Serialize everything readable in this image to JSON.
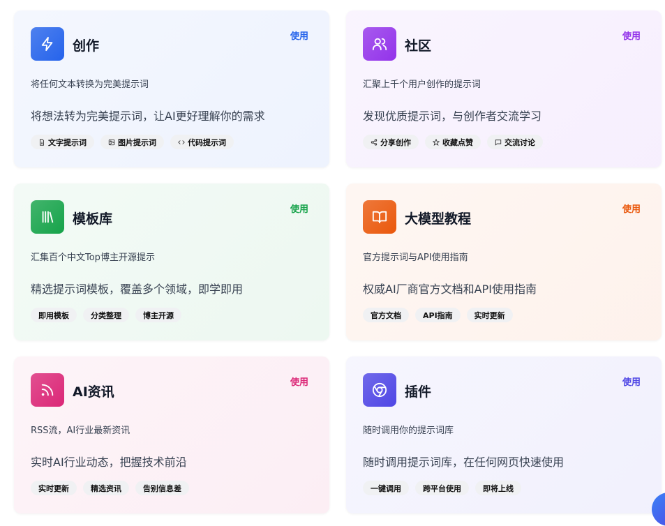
{
  "use_label": "使用",
  "cards": [
    {
      "title": "创作",
      "subtitle": "将任何文本转换为完美提示词",
      "description": "将想法转为完美提示词，让AI更好理解你的需求",
      "icon": "zap-icon",
      "accent": "#2563eb",
      "tags": [
        {
          "label": "文字提示词",
          "icon": "file-text-icon"
        },
        {
          "label": "图片提示词",
          "icon": "image-icon"
        },
        {
          "label": "代码提示词",
          "icon": "code-icon"
        }
      ]
    },
    {
      "title": "社区",
      "subtitle": "汇聚上千个用户创作的提示词",
      "description": "发现优质提示词，与创作者交流学习",
      "icon": "users-icon",
      "accent": "#9333ea",
      "tags": [
        {
          "label": "分享创作",
          "icon": "share-icon"
        },
        {
          "label": "收藏点赞",
          "icon": "star-icon"
        },
        {
          "label": "交流讨论",
          "icon": "message-icon"
        }
      ]
    },
    {
      "title": "模板库",
      "subtitle": "汇集百个中文Top博主开源提示",
      "description": "精选提示词模板，覆盖多个领域，即学即用",
      "icon": "library-icon",
      "accent": "#16a34a",
      "tags": [
        {
          "label": "即用模板"
        },
        {
          "label": "分类整理"
        },
        {
          "label": "博主开源"
        }
      ]
    },
    {
      "title": "大模型教程",
      "subtitle": "官方提示词与API使用指南",
      "description": "权威AI厂商官方文档和API使用指南",
      "icon": "book-open-icon",
      "accent": "#ea580c",
      "tags": [
        {
          "label": "官方文档"
        },
        {
          "label": "API指南"
        },
        {
          "label": "实时更新"
        }
      ]
    },
    {
      "title": "AI资讯",
      "subtitle": "RSS流，AI行业最新资讯",
      "description": "实时AI行业动态，把握技术前沿",
      "icon": "rss-icon",
      "accent": "#db2777",
      "tags": [
        {
          "label": "实时更新"
        },
        {
          "label": "精选资讯"
        },
        {
          "label": "告别信息差"
        }
      ]
    },
    {
      "title": "插件",
      "subtitle": "随时调用你的提示词库",
      "description": "随时调用提示词库，在任何网页快速使用",
      "icon": "chrome-icon",
      "accent": "#4f46e5",
      "tags": [
        {
          "label": "一键调用"
        },
        {
          "label": "跨平台使用"
        },
        {
          "label": "即将上线"
        }
      ]
    }
  ]
}
